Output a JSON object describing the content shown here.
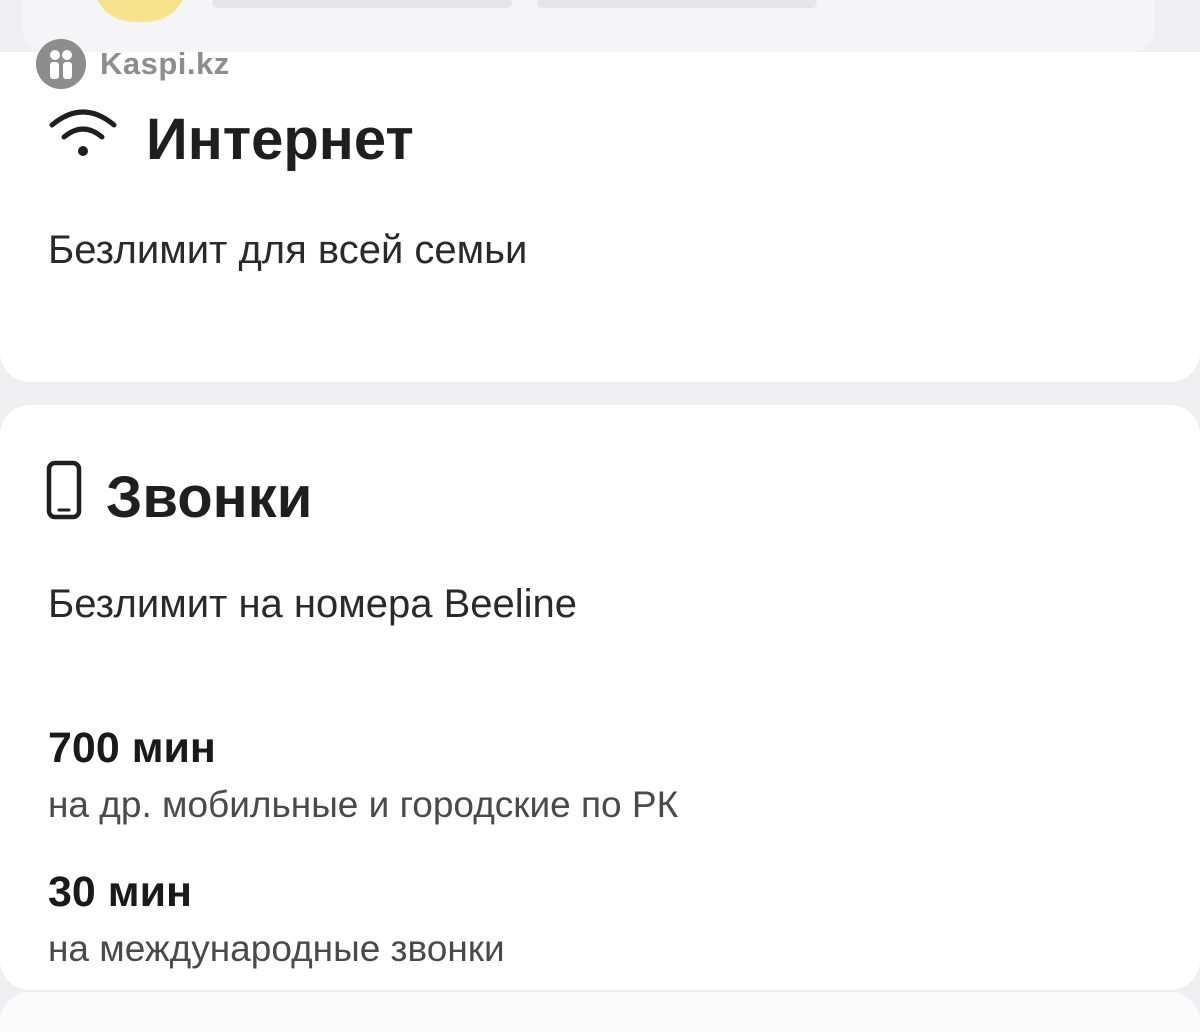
{
  "watermark": {
    "brand": "Kaspi.kz",
    "icon": "kaspi-logo"
  },
  "internet": {
    "icon": "wifi-icon",
    "title": "Интернет",
    "description": "Безлимит для всей семьи"
  },
  "calls": {
    "icon": "smartphone-icon",
    "title": "Звонки",
    "description": "Безлимит на номера Beeline",
    "items": [
      {
        "value": "700 мин",
        "label": "на др. мобильные и городские по РК"
      },
      {
        "value": "30 мин",
        "label": "на международные звонки"
      }
    ]
  },
  "colors": {
    "background": "#efeff1",
    "card": "#ffffff",
    "text_primary": "#1f1f1f",
    "text_secondary": "#4a4a4a",
    "watermark": "#8d8d8d",
    "accent_yellow": "#f6df7a"
  }
}
